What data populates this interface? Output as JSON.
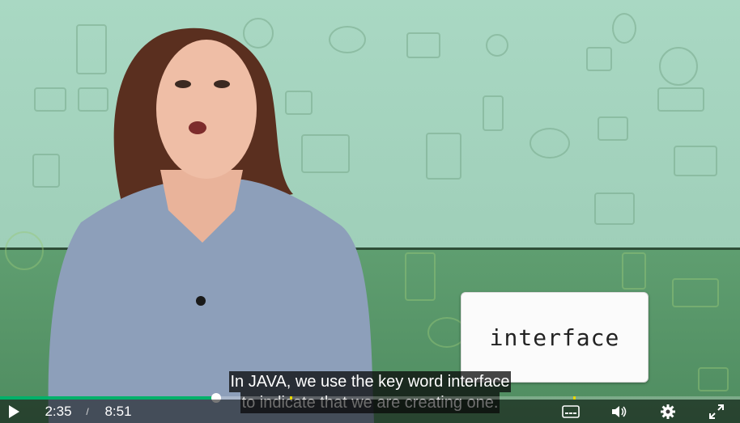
{
  "video": {
    "overlay_card_text": "interface",
    "captions": [
      "In JAVA, we use the key word interface",
      "to indicate that we are creating one."
    ]
  },
  "player": {
    "current_time": "2:35",
    "separator": "/",
    "duration": "8:51",
    "progress_fraction": 0.292,
    "chapter_markers": [
      0.392,
      0.775
    ],
    "colors": {
      "progress": "#00b16a",
      "marker": "#e5d600",
      "controls_bg": "#0a0a0a"
    },
    "icons": [
      "play-icon",
      "captions-icon",
      "volume-icon",
      "settings-gear-icon",
      "fullscreen-icon"
    ]
  }
}
